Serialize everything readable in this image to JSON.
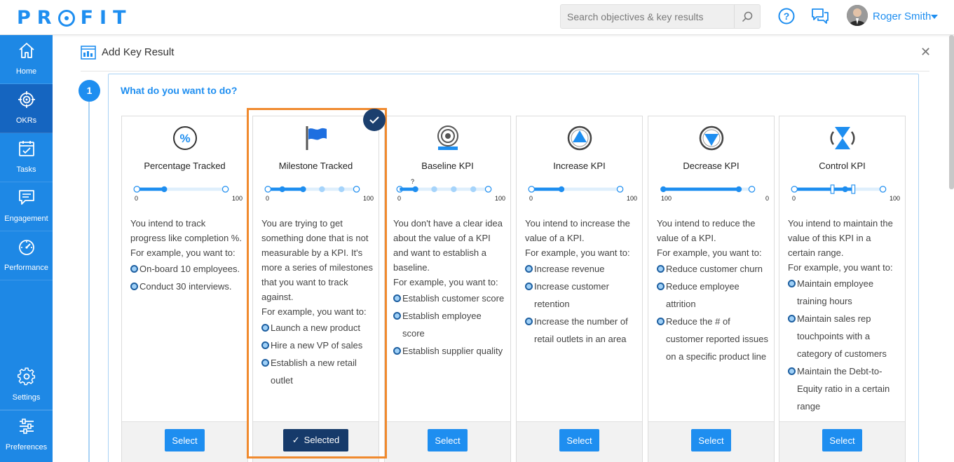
{
  "app": {
    "logo": "PROFIT"
  },
  "header": {
    "search_placeholder": "Search objectives & key results",
    "user_name": "Roger Smith"
  },
  "sidebar": {
    "items": [
      {
        "label": "Home",
        "icon": "home-icon"
      },
      {
        "label": "OKRs",
        "icon": "target-icon",
        "active": true
      },
      {
        "label": "Tasks",
        "icon": "tasks-icon"
      },
      {
        "label": "Engagement",
        "icon": "engagement-icon"
      },
      {
        "label": "Performance",
        "icon": "performance-icon"
      },
      {
        "label": "Settings",
        "icon": "gear-icon"
      },
      {
        "label": "Preferences",
        "icon": "preferences-icon"
      }
    ]
  },
  "dialog": {
    "title": "Add Key Result",
    "step_number": "1",
    "question": "What do you want to do?"
  },
  "cards": [
    {
      "title": "Percentage Tracked",
      "icon": "percent-icon",
      "slider_min": "0",
      "slider_max": "100",
      "desc": [
        "You intend to track progress like completion %."
      ],
      "example_intro": "For example, you want to:",
      "examples": [
        "On-board 10 employees.",
        "Conduct 30 interviews."
      ],
      "button": "Select"
    },
    {
      "title": "Milestone Tracked",
      "icon": "flag-icon",
      "slider_min": "0",
      "slider_max": "100",
      "desc": [
        "You are trying to get something done that is not measurable by a KPI. It's more a series of milestones that you want to track against."
      ],
      "example_intro": "For example, you want to:",
      "examples": [
        "Launch a new product",
        "Hire a new VP of sales",
        "Establish a new retail outlet"
      ],
      "button": "Selected",
      "selected": true
    },
    {
      "title": "Baseline KPI",
      "icon": "baseline-icon",
      "slider_min": "0",
      "slider_max": "100",
      "slider_marker": "?",
      "desc": [
        "You don't have a clear idea about the value of a KPI and want to establish a baseline."
      ],
      "example_intro": "For example, you want to:",
      "examples": [
        "Establish customer score",
        "Establish employee score",
        "Establish supplier quality"
      ],
      "button": "Select"
    },
    {
      "title": "Increase KPI",
      "icon": "increase-icon",
      "slider_min": "0",
      "slider_max": "100",
      "desc": [
        "You intend to increase the value of a KPI."
      ],
      "example_intro": "For example, you want to:",
      "examples": [
        "Increase revenue",
        "Increase customer retention",
        "Increase the number of retail outlets in an area"
      ],
      "button": "Select"
    },
    {
      "title": "Decrease KPI",
      "icon": "decrease-icon",
      "slider_min": "100",
      "slider_max": "0",
      "desc": [
        "You intend to reduce the value of a KPI."
      ],
      "example_intro": "For example, you want to:",
      "examples": [
        "Reduce customer churn",
        "Reduce employee attrition",
        "Reduce the # of customer reported issues on a specific product line"
      ],
      "button": "Select"
    },
    {
      "title": "Control KPI",
      "icon": "control-icon",
      "slider_min": "0",
      "slider_max": "100",
      "desc": [
        "You intend to maintain the value of this KPI in a certain range."
      ],
      "example_intro": "For example, you want to:",
      "examples": [
        "Maintain employee training hours",
        "Maintain sales rep touchpoints with a category of customers",
        "Maintain the Debt-to-Equity ratio in a certain range"
      ],
      "button": "Select"
    }
  ]
}
